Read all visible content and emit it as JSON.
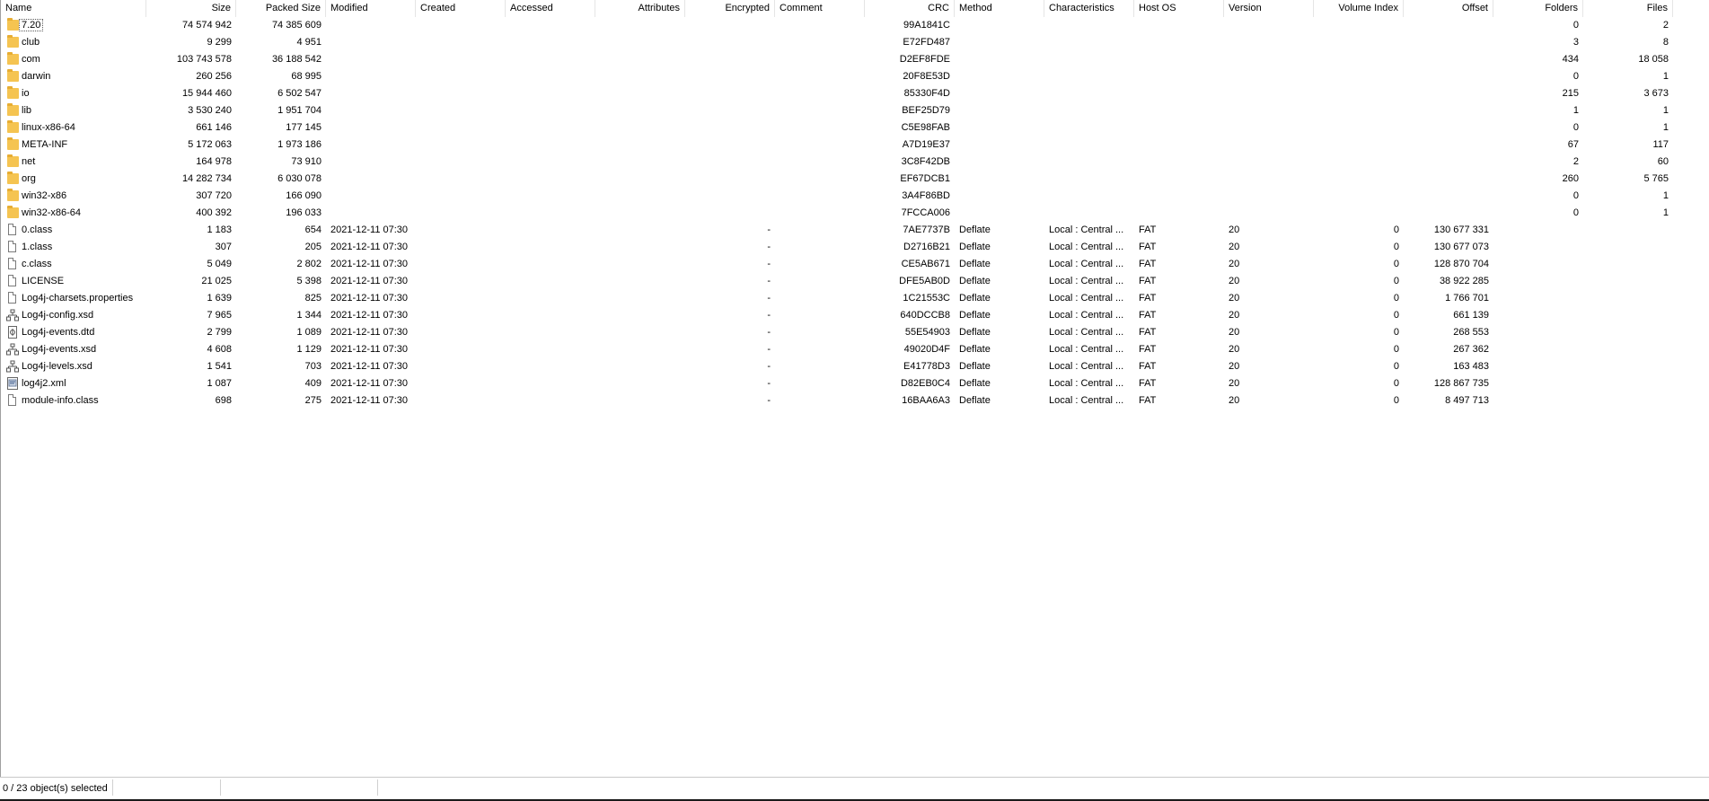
{
  "columns": [
    {
      "key": "name",
      "label": "Name"
    },
    {
      "key": "size",
      "label": "Size"
    },
    {
      "key": "packed",
      "label": "Packed Size"
    },
    {
      "key": "modified",
      "label": "Modified"
    },
    {
      "key": "created",
      "label": "Created"
    },
    {
      "key": "accessed",
      "label": "Accessed"
    },
    {
      "key": "attributes",
      "label": "Attributes"
    },
    {
      "key": "encrypted",
      "label": "Encrypted"
    },
    {
      "key": "comment",
      "label": "Comment"
    },
    {
      "key": "crc",
      "label": "CRC"
    },
    {
      "key": "method",
      "label": "Method"
    },
    {
      "key": "characteristics",
      "label": "Characteristics"
    },
    {
      "key": "hostos",
      "label": "Host OS"
    },
    {
      "key": "version",
      "label": "Version"
    },
    {
      "key": "volindex",
      "label": "Volume Index"
    },
    {
      "key": "offset",
      "label": "Offset"
    },
    {
      "key": "folders",
      "label": "Folders"
    },
    {
      "key": "files",
      "label": "Files"
    }
  ],
  "rows": [
    {
      "icon": "folder-icon",
      "name": "7.20",
      "size": "74 574 942",
      "packed": "74 385 609",
      "modified": "",
      "encrypted": "",
      "crc": "99A1841C",
      "method": "",
      "characteristics": "",
      "hostos": "",
      "version": "",
      "volindex": "",
      "offset": "",
      "folders": "0",
      "files": "2"
    },
    {
      "icon": "folder-icon",
      "name": "club",
      "size": "9 299",
      "packed": "4 951",
      "modified": "",
      "encrypted": "",
      "crc": "E72FD487",
      "method": "",
      "characteristics": "",
      "hostos": "",
      "version": "",
      "volindex": "",
      "offset": "",
      "folders": "3",
      "files": "8"
    },
    {
      "icon": "folder-icon",
      "name": "com",
      "size": "103 743 578",
      "packed": "36 188 542",
      "modified": "",
      "encrypted": "",
      "crc": "D2EF8FDE",
      "method": "",
      "characteristics": "",
      "hostos": "",
      "version": "",
      "volindex": "",
      "offset": "",
      "folders": "434",
      "files": "18 058"
    },
    {
      "icon": "folder-icon",
      "name": "darwin",
      "size": "260 256",
      "packed": "68 995",
      "modified": "",
      "encrypted": "",
      "crc": "20F8E53D",
      "method": "",
      "characteristics": "",
      "hostos": "",
      "version": "",
      "volindex": "",
      "offset": "",
      "folders": "0",
      "files": "1"
    },
    {
      "icon": "folder-icon",
      "name": "io",
      "size": "15 944 460",
      "packed": "6 502 547",
      "modified": "",
      "encrypted": "",
      "crc": "85330F4D",
      "method": "",
      "characteristics": "",
      "hostos": "",
      "version": "",
      "volindex": "",
      "offset": "",
      "folders": "215",
      "files": "3 673"
    },
    {
      "icon": "folder-icon",
      "name": "lib",
      "size": "3 530 240",
      "packed": "1 951 704",
      "modified": "",
      "encrypted": "",
      "crc": "BEF25D79",
      "method": "",
      "characteristics": "",
      "hostos": "",
      "version": "",
      "volindex": "",
      "offset": "",
      "folders": "1",
      "files": "1"
    },
    {
      "icon": "folder-icon",
      "name": "linux-x86-64",
      "size": "661 146",
      "packed": "177 145",
      "modified": "",
      "encrypted": "",
      "crc": "C5E98FAB",
      "method": "",
      "characteristics": "",
      "hostos": "",
      "version": "",
      "volindex": "",
      "offset": "",
      "folders": "0",
      "files": "1"
    },
    {
      "icon": "folder-icon",
      "name": "META-INF",
      "size": "5 172 063",
      "packed": "1 973 186",
      "modified": "",
      "encrypted": "",
      "crc": "A7D19E37",
      "method": "",
      "characteristics": "",
      "hostos": "",
      "version": "",
      "volindex": "",
      "offset": "",
      "folders": "67",
      "files": "117"
    },
    {
      "icon": "folder-icon",
      "name": "net",
      "size": "164 978",
      "packed": "73 910",
      "modified": "",
      "encrypted": "",
      "crc": "3C8F42DB",
      "method": "",
      "characteristics": "",
      "hostos": "",
      "version": "",
      "volindex": "",
      "offset": "",
      "folders": "2",
      "files": "60"
    },
    {
      "icon": "folder-icon",
      "name": "org",
      "size": "14 282 734",
      "packed": "6 030 078",
      "modified": "",
      "encrypted": "",
      "crc": "EF67DCB1",
      "method": "",
      "characteristics": "",
      "hostos": "",
      "version": "",
      "volindex": "",
      "offset": "",
      "folders": "260",
      "files": "5 765"
    },
    {
      "icon": "folder-icon",
      "name": "win32-x86",
      "size": "307 720",
      "packed": "166 090",
      "modified": "",
      "encrypted": "",
      "crc": "3A4F86BD",
      "method": "",
      "characteristics": "",
      "hostos": "",
      "version": "",
      "volindex": "",
      "offset": "",
      "folders": "0",
      "files": "1"
    },
    {
      "icon": "folder-icon",
      "name": "win32-x86-64",
      "size": "400 392",
      "packed": "196 033",
      "modified": "",
      "encrypted": "",
      "crc": "7FCCA006",
      "method": "",
      "characteristics": "",
      "hostos": "",
      "version": "",
      "volindex": "",
      "offset": "",
      "folders": "0",
      "files": "1"
    },
    {
      "icon": "file-icon",
      "name": "0.class",
      "size": "1 183",
      "packed": "654",
      "modified": "2021-12-11 07:30",
      "encrypted": "-",
      "crc": "7AE7737B",
      "method": "Deflate",
      "characteristics": "Local : Central ...",
      "hostos": "FAT",
      "version": "20",
      "volindex": "0",
      "offset": "130 677 331",
      "folders": "",
      "files": ""
    },
    {
      "icon": "file-icon",
      "name": "1.class",
      "size": "307",
      "packed": "205",
      "modified": "2021-12-11 07:30",
      "encrypted": "-",
      "crc": "D2716B21",
      "method": "Deflate",
      "characteristics": "Local : Central ...",
      "hostos": "FAT",
      "version": "20",
      "volindex": "0",
      "offset": "130 677 073",
      "folders": "",
      "files": ""
    },
    {
      "icon": "file-icon",
      "name": "c.class",
      "size": "5 049",
      "packed": "2 802",
      "modified": "2021-12-11 07:30",
      "encrypted": "-",
      "crc": "CE5AB671",
      "method": "Deflate",
      "characteristics": "Local : Central ...",
      "hostos": "FAT",
      "version": "20",
      "volindex": "0",
      "offset": "128 870 704",
      "folders": "",
      "files": ""
    },
    {
      "icon": "file-icon",
      "name": "LICENSE",
      "size": "21 025",
      "packed": "5 398",
      "modified": "2021-12-11 07:30",
      "encrypted": "-",
      "crc": "DFE5AB0D",
      "method": "Deflate",
      "characteristics": "Local : Central ...",
      "hostos": "FAT",
      "version": "20",
      "volindex": "0",
      "offset": "38 922 285",
      "folders": "",
      "files": ""
    },
    {
      "icon": "file-icon",
      "name": "Log4j-charsets.properties",
      "size": "1 639",
      "packed": "825",
      "modified": "2021-12-11 07:30",
      "encrypted": "-",
      "crc": "1C21553C",
      "method": "Deflate",
      "characteristics": "Local : Central ...",
      "hostos": "FAT",
      "version": "20",
      "volindex": "0",
      "offset": "1 766 701",
      "folders": "",
      "files": ""
    },
    {
      "icon": "xsd-icon",
      "name": "Log4j-config.xsd",
      "size": "7 965",
      "packed": "1 344",
      "modified": "2021-12-11 07:30",
      "encrypted": "-",
      "crc": "640DCCB8",
      "method": "Deflate",
      "characteristics": "Local : Central ...",
      "hostos": "FAT",
      "version": "20",
      "volindex": "0",
      "offset": "661 139",
      "folders": "",
      "files": ""
    },
    {
      "icon": "dtd-icon",
      "name": "Log4j-events.dtd",
      "size": "2 799",
      "packed": "1 089",
      "modified": "2021-12-11 07:30",
      "encrypted": "-",
      "crc": "55E54903",
      "method": "Deflate",
      "characteristics": "Local : Central ...",
      "hostos": "FAT",
      "version": "20",
      "volindex": "0",
      "offset": "268 553",
      "folders": "",
      "files": ""
    },
    {
      "icon": "xsd-icon",
      "name": "Log4j-events.xsd",
      "size": "4 608",
      "packed": "1 129",
      "modified": "2021-12-11 07:30",
      "encrypted": "-",
      "crc": "49020D4F",
      "method": "Deflate",
      "characteristics": "Local : Central ...",
      "hostos": "FAT",
      "version": "20",
      "volindex": "0",
      "offset": "267 362",
      "folders": "",
      "files": ""
    },
    {
      "icon": "xsd-icon",
      "name": "Log4j-levels.xsd",
      "size": "1 541",
      "packed": "703",
      "modified": "2021-12-11 07:30",
      "encrypted": "-",
      "crc": "E41778D3",
      "method": "Deflate",
      "characteristics": "Local : Central ...",
      "hostos": "FAT",
      "version": "20",
      "volindex": "0",
      "offset": "163 483",
      "folders": "",
      "files": ""
    },
    {
      "icon": "xml-icon",
      "name": "log4j2.xml",
      "size": "1 087",
      "packed": "409",
      "modified": "2021-12-11 07:30",
      "encrypted": "-",
      "crc": "D82EB0C4",
      "method": "Deflate",
      "characteristics": "Local : Central ...",
      "hostos": "FAT",
      "version": "20",
      "volindex": "0",
      "offset": "128 867 735",
      "folders": "",
      "files": ""
    },
    {
      "icon": "file-icon",
      "name": "module-info.class",
      "size": "698",
      "packed": "275",
      "modified": "2021-12-11 07:30",
      "encrypted": "-",
      "crc": "16BAA6A3",
      "method": "Deflate",
      "characteristics": "Local : Central ...",
      "hostos": "FAT",
      "version": "20",
      "volindex": "0",
      "offset": "8 497 713",
      "folders": "",
      "files": ""
    }
  ],
  "status": {
    "selection": "0 / 23 object(s) selected"
  }
}
